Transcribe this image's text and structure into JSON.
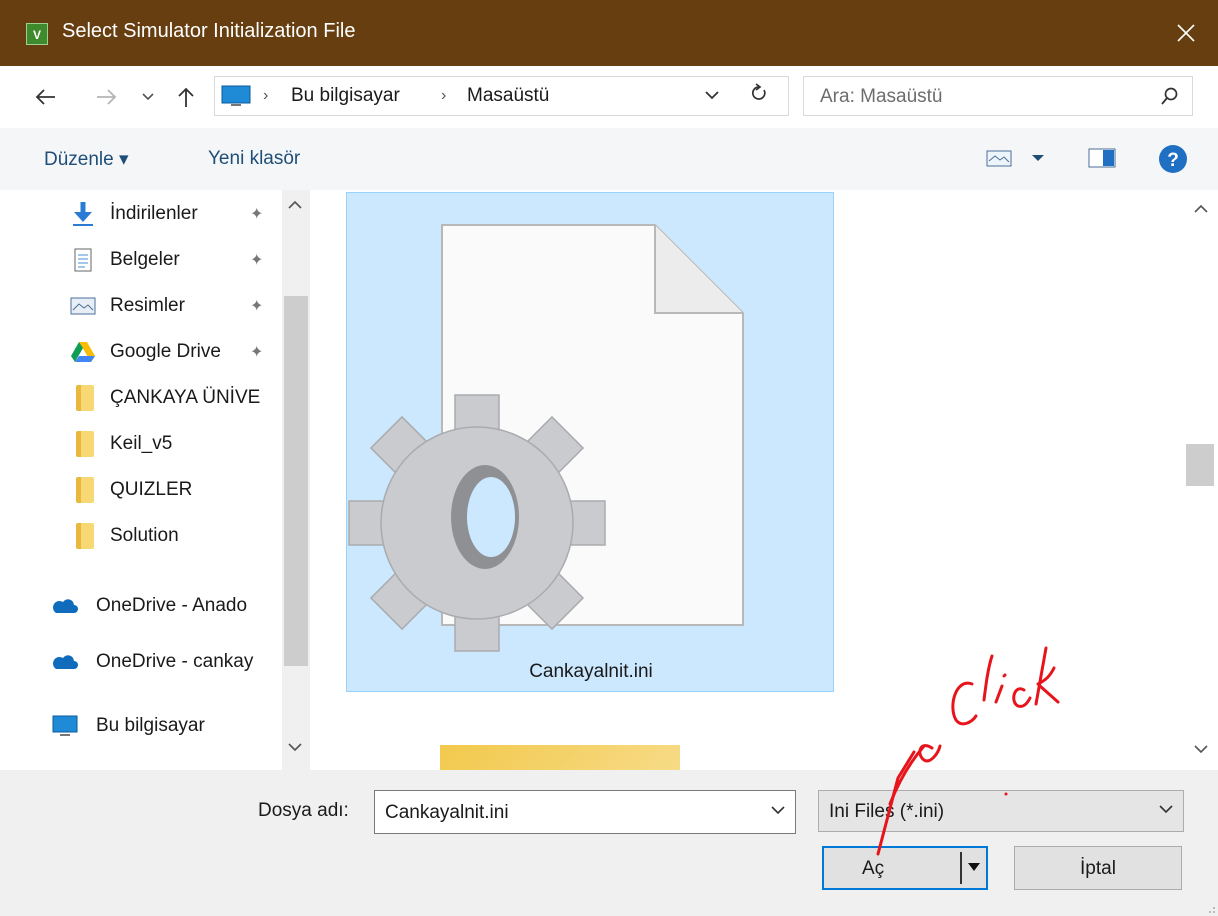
{
  "window": {
    "title": "Select Simulator Initialization File",
    "app_icon_text": "V"
  },
  "nav": {
    "breadcrumbs": [
      "Bu bilgisayar",
      "Masaüstü"
    ],
    "search_placeholder": "Ara: Masaüstü"
  },
  "toolbar": {
    "organize_label": "Düzenle ▾",
    "new_folder_label": "Yeni klasör"
  },
  "sidebar": {
    "items": [
      {
        "label": "İndirilenler",
        "icon": "download-arrow-icon",
        "pinned": true
      },
      {
        "label": "Belgeler",
        "icon": "documents-icon",
        "pinned": true
      },
      {
        "label": "Resimler",
        "icon": "pictures-icon",
        "pinned": true
      },
      {
        "label": "Google Drive",
        "icon": "google-drive-icon",
        "pinned": true
      },
      {
        "label": "ÇANKAYA ÜNİVE",
        "icon": "folder-icon",
        "pinned": false
      },
      {
        "label": "Keil_v5",
        "icon": "folder-icon",
        "pinned": false
      },
      {
        "label": "QUIZLER",
        "icon": "folder-icon",
        "pinned": false
      },
      {
        "label": "Solution",
        "icon": "folder-icon",
        "pinned": false
      },
      {
        "label": "OneDrive - Anado",
        "icon": "onedrive-cloud-icon",
        "pinned": false
      },
      {
        "label": "OneDrive - cankay",
        "icon": "onedrive-cloud-icon",
        "pinned": false
      },
      {
        "label": "Bu bilgisayar",
        "icon": "this-pc-icon",
        "pinned": false
      }
    ]
  },
  "files": {
    "selected_file": "Cankayalnit.ini"
  },
  "bottom": {
    "filename_label": "Dosya adı:",
    "filename_value": "Cankayalnit.ini",
    "filetype_value": "Ini Files (*.ini)",
    "open_label": "Aç",
    "cancel_label": "İptal"
  },
  "annotation": {
    "text": "click"
  },
  "colors": {
    "titlebar": "#663e0f",
    "selection": "#cce8ff",
    "accent": "#0078d7",
    "annotation": "#e8141b"
  }
}
